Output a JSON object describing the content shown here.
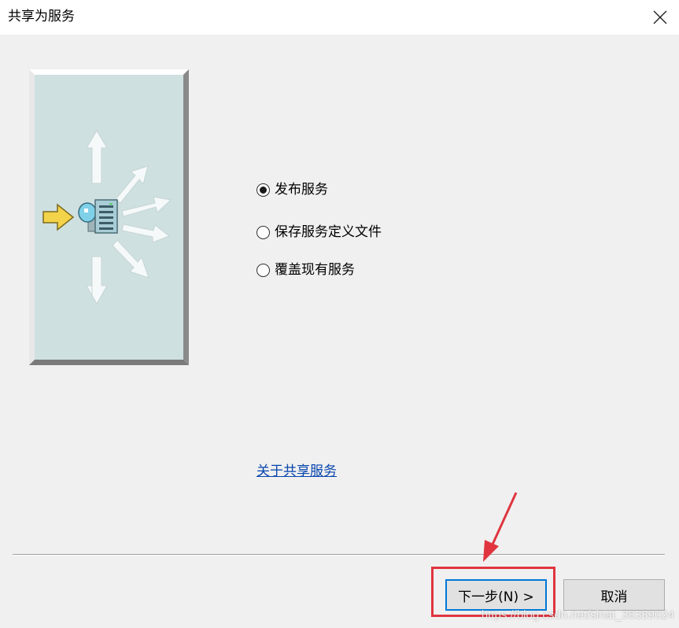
{
  "window": {
    "title": "共享为服务",
    "close_icon": "close-icon"
  },
  "options": [
    {
      "label": "发布服务",
      "checked": true
    },
    {
      "label": "保存服务定义文件",
      "checked": false
    },
    {
      "label": "覆盖现有服务",
      "checked": false
    }
  ],
  "help_link": "关于共享服务",
  "buttons": {
    "next_label": "下一步(N) >",
    "cancel_label": "取消"
  },
  "watermark": "https://blog.csdn.net/sinat_38389024",
  "colors": {
    "accent": "#0078d7",
    "annotation": "#e0353f",
    "link": "#0645ad",
    "panel": "#cfe0e0"
  }
}
